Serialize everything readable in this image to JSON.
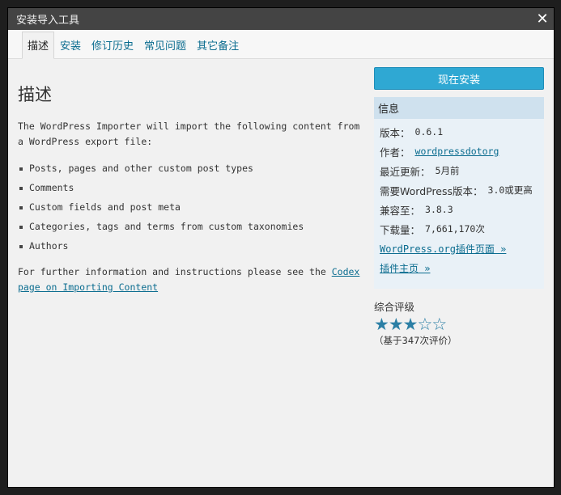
{
  "window": {
    "title": "安装导入工具"
  },
  "tabs": [
    {
      "label": "描述",
      "active": true
    },
    {
      "label": "安装"
    },
    {
      "label": "修订历史"
    },
    {
      "label": "常见问题"
    },
    {
      "label": "其它备注"
    }
  ],
  "description": {
    "heading": "描述",
    "intro": "The WordPress Importer will import the following content from a WordPress export file:",
    "items": [
      "Posts, pages and other custom post types",
      "Comments",
      "Custom fields and post meta",
      "Categories, tags and terms from custom taxonomies",
      "Authors"
    ],
    "further_text": "For further information and instructions please see the ",
    "further_link": "Codex page on Importing Content"
  },
  "sidebar": {
    "install_button": "现在安装",
    "info_title": "信息",
    "version_label": "版本：",
    "version": "0.6.1",
    "author_label": "作者：",
    "author": "wordpressdotorg",
    "updated_label": "最近更新：",
    "updated": "5月前",
    "requires_label": "需要WordPress版本：",
    "requires": "3.0或更高",
    "compat_label": "兼容至：",
    "compat": "3.8.3",
    "downloads_label": "下载量：",
    "downloads": "7,661,170次",
    "plugin_page_link": "WordPress.org插件页面 »",
    "homepage_link": "插件主页 »",
    "rating_title": "综合评级",
    "rating_stars": 3,
    "rating_max": 5,
    "rating_count": "（基于347次评价）"
  },
  "colors": {
    "link": "#0a6c8f",
    "button": "#2fa8d3",
    "titlebar": "#444444",
    "info_header": "#cfe1ee"
  }
}
